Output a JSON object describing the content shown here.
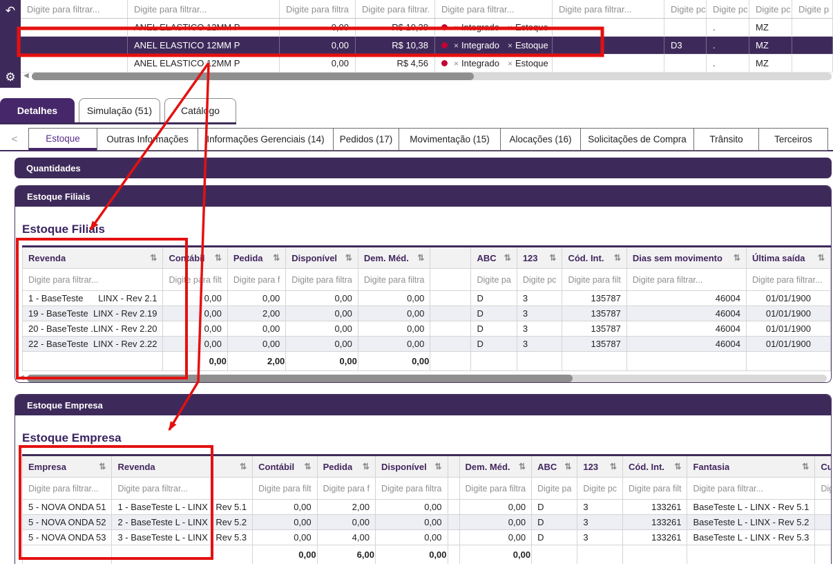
{
  "colors": {
    "brand_purple": "#3E2A5A",
    "active_tab_purple": "#46286A",
    "header_text_purple": "#42265E",
    "active_tab_text_purple": "#5B2B8A",
    "annotation_red": "#E51010",
    "status_dot_red": "#C40233",
    "zebra_row": "#EDEFF4"
  },
  "icons": {
    "back": "↶",
    "gear": "⚙",
    "scroll_left": "◀",
    "sort": "⇅",
    "chevron_left": "<",
    "tag_x": "×"
  },
  "top_grid": {
    "filters": [
      "Digite para filtrar...",
      "Digite para filtrar...",
      "Digite para filtra",
      "Digite para filtrar.",
      "Digite para filtrar...",
      "Digite para filtrar...",
      "Digite pc",
      "Digite pc",
      "Digite pc",
      "Digite p"
    ],
    "rows": [
      {
        "product": "ANEL ELASTICO 12MM P",
        "qty": "0,00",
        "price": "R$ 10,38",
        "tag1": "Integrado",
        "tag2": "Estoque",
        "col_d": "",
        "col_dot": ".",
        "col_mz": "MZ"
      },
      {
        "product": "ANEL ELASTICO 12MM P",
        "qty": "0,00",
        "price": "R$ 10,38",
        "tag1": "Integrado",
        "tag2": "Estoque",
        "col_d": "D3",
        "col_dot": ".",
        "col_mz": "MZ"
      },
      {
        "product": "ANEL ELASTICO 12MM P",
        "qty": "0,00",
        "price": "R$ 4,56",
        "tag1": "Integrado",
        "tag2": "Estoque",
        "col_d": "",
        "col_dot": ".",
        "col_mz": "MZ"
      }
    ]
  },
  "tabs_primary": [
    {
      "label": "Detalhes",
      "active": true
    },
    {
      "label": "Simulação (51)",
      "active": false
    },
    {
      "label": "Catálogo",
      "active": false
    }
  ],
  "tabs_secondary": [
    {
      "label": "Estoque",
      "active": true
    },
    {
      "label": "Outras Informações",
      "active": false
    },
    {
      "label": "Informações Gerenciais (14)",
      "active": false
    },
    {
      "label": "Pedidos (17)",
      "active": false
    },
    {
      "label": "Movimentação (15)",
      "active": false
    },
    {
      "label": "Alocações (16)",
      "active": false
    },
    {
      "label": "Solicitações de Compra",
      "active": false
    },
    {
      "label": "Trânsito",
      "active": false
    },
    {
      "label": "Terceiros",
      "active": false
    }
  ],
  "sections": {
    "quantidades": "Quantidades",
    "filiais_bar": "Estoque Filiais",
    "filiais_heading": "Estoque Filiais",
    "empresa_bar": "Estoque Empresa",
    "empresa_heading": "Estoque Empresa"
  },
  "filiais_table": {
    "columns": [
      "Revenda",
      "Contábil",
      "Pedida",
      "Disponível",
      "Dem. Méd.",
      "",
      "ABC",
      "123",
      "Cód. Int.",
      "Dias sem movimento",
      "Última saída"
    ],
    "filters": [
      "Digite para filtrar...",
      "Digite para filt",
      "Digite para f",
      "Digite para filtra",
      "Digite para filtra",
      "",
      "Digite pa",
      "Digite pc",
      "Digite para filt",
      "Digite para filtrar...",
      "Digite para filtrar..."
    ],
    "rows": [
      [
        {
          "l": "1 - BaseTeste",
          "r": "LINX - Rev 2.1"
        },
        "0,00",
        "0,00",
        "0,00",
        "0,00",
        "",
        "D",
        "3",
        "135787",
        "46004",
        "01/01/1900"
      ],
      [
        {
          "l": "19 - BaseTeste",
          "r": "LINX - Rev 2.19"
        },
        "0,00",
        "2,00",
        "0,00",
        "0,00",
        "",
        "D",
        "3",
        "135787",
        "46004",
        "01/01/1900"
      ],
      [
        {
          "l": "20 - BaseTeste .",
          "r": "LINX - Rev 2.20"
        },
        "0,00",
        "0,00",
        "0,00",
        "0,00",
        "",
        "D",
        "3",
        "135787",
        "46004",
        "01/01/1900"
      ],
      [
        {
          "l": "22 - BaseTeste",
          "r": "LINX - Rev 2.22"
        },
        "0,00",
        "0,00",
        "0,00",
        "0,00",
        "",
        "D",
        "3",
        "135787",
        "46004",
        "01/01/1900"
      ]
    ],
    "totals": [
      "",
      "0,00",
      "2,00",
      "0,00",
      "0,00",
      "",
      "",
      "",
      "",
      "",
      ""
    ]
  },
  "empresa_table": {
    "columns": [
      "Empresa",
      "Revenda",
      "Contábil",
      "Pedida",
      "Disponível",
      "",
      "Dem. Méd.",
      "ABC",
      "123",
      "Cód. Int.",
      "Fantasia",
      "Custo"
    ],
    "filters": [
      "Digite para filtrar...",
      "Digite para filtrar...",
      "Digite para filt",
      "Digite para f",
      "Digite para filtra",
      "",
      "Digite para filtra",
      "Digite pa",
      "Digite pc",
      "Digite para filt",
      "Digite para filtrar...",
      "Digite p"
    ],
    "rows": [
      [
        "5 - NOVA ONDA 51",
        "1 - BaseTeste L - LINX - Rev 5.1",
        "0,00",
        "2,00",
        "0,00",
        "",
        "0,00",
        "D",
        "3",
        "133261",
        "BaseTeste L - LINX - Rev 5.1",
        ""
      ],
      [
        "5 - NOVA ONDA 52",
        "2 - BaseTeste L - LINX - Rev 5.2",
        "0,00",
        "0,00",
        "0,00",
        "",
        "0,00",
        "D",
        "3",
        "133261",
        "BaseTeste L - LINX - Rev 5.2",
        ""
      ],
      [
        "5 - NOVA ONDA 53",
        "3 - BaseTeste L - LINX - Rev 5.3",
        "0,00",
        "4,00",
        "0,00",
        "",
        "0,00",
        "D",
        "3",
        "133261",
        "BaseTeste L - LINX - Rev 5.3",
        ""
      ]
    ],
    "totals": [
      "",
      "",
      "0,00",
      "6,00",
      "0,00",
      "",
      "0,00",
      "",
      "",
      "",
      "",
      ""
    ]
  }
}
